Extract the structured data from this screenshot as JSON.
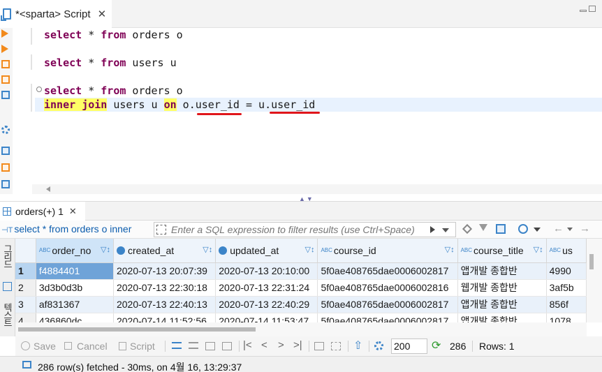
{
  "editor_tab": {
    "title": "*<sparta> Script",
    "close": "✕"
  },
  "code": {
    "line1_kw1": "select",
    "line1_mid": " * ",
    "line1_kw2": "from",
    "line1_rest": " orders o",
    "line2_kw1": "select",
    "line2_mid": " * ",
    "line2_kw2": "from",
    "line2_rest": " users u",
    "line3_kw1": "select",
    "line3_mid": " * ",
    "line3_kw2": "from",
    "line3_rest": " orders o",
    "line4_kw1": "inner",
    "line4_sp1": " ",
    "line4_kw2": "join",
    "line4_mid": " users u ",
    "line4_kw3": "on",
    "line4_rest": " o.user_id = u.user_id"
  },
  "results": {
    "tab_label": "orders(+) 1",
    "tab_close": "✕",
    "query_label": "select * from orders o inner",
    "filter_placeholder": "Enter a SQL expression to filter results (use Ctrl+Space)"
  },
  "vertical_tabs": {
    "grid": "그리드",
    "text": "텍스트"
  },
  "grid": {
    "columns": [
      {
        "name": "order_no",
        "type_icon": "ABC"
      },
      {
        "name": "created_at",
        "type_icon": "clock"
      },
      {
        "name": "updated_at",
        "type_icon": "clock"
      },
      {
        "name": "course_id",
        "type_icon": "ABC"
      },
      {
        "name": "course_title",
        "type_icon": "ABC"
      },
      {
        "name": "us",
        "type_icon": "ABC"
      }
    ],
    "rows": [
      {
        "num": "1",
        "order_no": "f4884401",
        "created_at": "2020-07-13 20:07:39",
        "updated_at": "2020-07-13 20:10:00",
        "course_id": "5f0ae408765dae0006002817",
        "course_title": "앱개발 종합반",
        "user": "4990"
      },
      {
        "num": "2",
        "order_no": "3d3b0d3b",
        "created_at": "2020-07-13 22:30:18",
        "updated_at": "2020-07-13 22:31:24",
        "course_id": "5f0ae408765dae0006002816",
        "course_title": "웹개발 종합반",
        "user": "3af5b"
      },
      {
        "num": "3",
        "order_no": "af831367",
        "created_at": "2020-07-13 22:40:13",
        "updated_at": "2020-07-13 22:40:29",
        "course_id": "5f0ae408765dae0006002817",
        "course_title": "앱개발 종합반",
        "user": "856f"
      },
      {
        "num": "4",
        "order_no": "436860dc",
        "created_at": "2020-07-14 11:52:56",
        "updated_at": "2020-07-14 11:53:47",
        "course_id": "5f0ae408765dae0006002817",
        "course_title": "앱개발 종합반",
        "user": "1078"
      }
    ]
  },
  "bottom_toolbar": {
    "save": "Save",
    "cancel": "Cancel",
    "script": "Script",
    "fetch_size": "200",
    "fetched_count": "286",
    "rows_label": "Rows: 1"
  },
  "status": {
    "text": "286 row(s) fetched - 30ms, on 4월 16, 13:29:37"
  },
  "colors": {
    "keyword": "#7f0055",
    "highlight": "#ffff66",
    "underline": "#e0161b",
    "accent": "#3c84c8",
    "selected_cell": "#6fa3d8"
  }
}
